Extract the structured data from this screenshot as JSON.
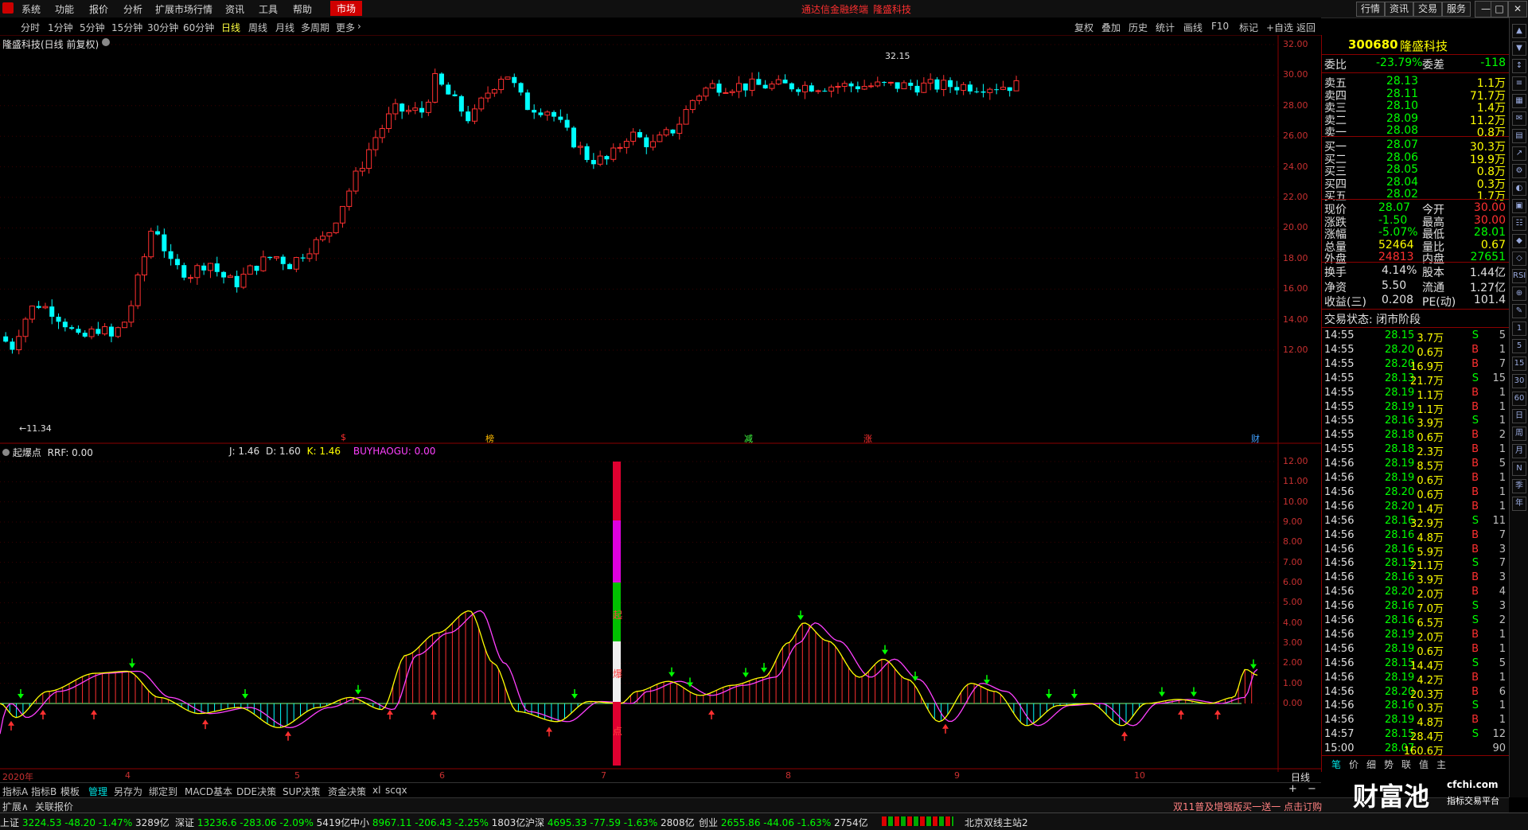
{
  "titlebar": {
    "menu": [
      "系统",
      "功能",
      "报价",
      "分析",
      "扩展市场行情",
      "资讯",
      "工具",
      "帮助"
    ],
    "market_tab": "市场",
    "title": "通达信金融终端",
    "stock_title": "隆盛科技",
    "right_buttons": [
      "行情",
      "资讯",
      "交易",
      "服务"
    ],
    "window_controls": [
      "—",
      "□",
      "✕"
    ]
  },
  "periodbar": {
    "periods": [
      "分时",
      "1分钟",
      "5分钟",
      "15分钟",
      "30分钟",
      "60分钟",
      "日线",
      "周线",
      "月线",
      "多周期",
      "更多"
    ],
    "active_period": "日线",
    "tools": [
      "复权",
      "叠加",
      "历史",
      "统计",
      "画线",
      "F10",
      "标记",
      "+自选",
      "返回"
    ]
  },
  "main_chart": {
    "label": "隆盛科技(日线 前复权)",
    "high_label": "32.15",
    "low_label": "11.34",
    "y_ticks": [
      "32.00",
      "30.00",
      "28.00",
      "26.00",
      "24.00",
      "22.00",
      "20.00",
      "18.00",
      "16.00",
      "14.00",
      "12.00"
    ],
    "markers": [
      "$",
      "榜",
      "减",
      "涨",
      "财"
    ],
    "colors": {
      "up": "#ff3030",
      "down": "#00ffff",
      "bg": "#000000",
      "grid": "#5a0000"
    }
  },
  "indicator": {
    "name": "起爆点",
    "values": [
      {
        "label": "RRF: 0.00",
        "color": "#e0e0e0"
      },
      {
        "label": "J: 1.46",
        "color": "#e0e0e0"
      },
      {
        "label": "D: 1.60",
        "color": "#e0e0e0"
      },
      {
        "label": "K: 1.46",
        "color": "#ffff00"
      },
      {
        "label": "BUYHAOGU: 0.00",
        "color": "#ff40ff"
      }
    ],
    "y_ticks": [
      "12.00",
      "11.00",
      "10.00",
      "9.00",
      "8.00",
      "7.00",
      "6.00",
      "5.00",
      "4.00",
      "3.00",
      "2.00",
      "1.00",
      "0.00"
    ],
    "bar_text": [
      "起",
      "爆",
      "点"
    ]
  },
  "date_axis": [
    "2020年",
    "4",
    "5",
    "6",
    "7",
    "8",
    "9",
    "10"
  ],
  "period_tag": "日线",
  "bottom_tabs": [
    "指标A",
    "指标B",
    "模板",
    "管理",
    "另存为",
    "绑定到",
    "MACD基本",
    "DDE决策",
    "SUP决策",
    "资金决策",
    "xl",
    "scqx"
  ],
  "active_tab": "管理",
  "bottom_row2": [
    "扩展∧",
    "关联报价"
  ],
  "ad_text": "双11普及增强版买一送一 点击订购",
  "quote": {
    "code": "300680",
    "name": "隆盛科技",
    "weibi": {
      "label": "委比",
      "value": "-23.79%",
      "label2": "委差",
      "value2": "-118"
    },
    "sell": [
      {
        "label": "卖五",
        "price": "28.13",
        "vol": "1.1万"
      },
      {
        "label": "卖四",
        "price": "28.11",
        "vol": "71.7万"
      },
      {
        "label": "卖三",
        "price": "28.10",
        "vol": "1.4万"
      },
      {
        "label": "卖二",
        "price": "28.09",
        "vol": "11.2万"
      },
      {
        "label": "卖一",
        "price": "28.08",
        "vol": "0.8万"
      }
    ],
    "buy": [
      {
        "label": "买一",
        "price": "28.07",
        "vol": "30.3万"
      },
      {
        "label": "买二",
        "price": "28.06",
        "vol": "19.9万"
      },
      {
        "label": "买三",
        "price": "28.05",
        "vol": "0.8万"
      },
      {
        "label": "买四",
        "price": "28.04",
        "vol": "0.3万"
      },
      {
        "label": "买五",
        "price": "28.02",
        "vol": "1.7万"
      }
    ],
    "stats": [
      {
        "l1": "现价",
        "v1": "28.07",
        "l2": "今开",
        "v2": "30.00",
        "c1": "#00ff00",
        "c2": "#ff3030"
      },
      {
        "l1": "涨跌",
        "v1": "-1.50",
        "l2": "最高",
        "v2": "30.00",
        "c1": "#00ff00",
        "c2": "#ff3030"
      },
      {
        "l1": "涨幅",
        "v1": "-5.07%",
        "l2": "最低",
        "v2": "28.01",
        "c1": "#00ff00",
        "c2": "#00ff00"
      },
      {
        "l1": "总量",
        "v1": "52464",
        "l2": "量比",
        "v2": "0.67",
        "c1": "#ffff00",
        "c2": "#ffff00"
      },
      {
        "l1": "外盘",
        "v1": "24813",
        "l2": "内盘",
        "v2": "27651",
        "c1": "#ff3030",
        "c2": "#00ff00"
      }
    ],
    "stats2": [
      {
        "l1": "换手",
        "v1": "4.14%",
        "l2": "股本",
        "v2": "1.44亿"
      },
      {
        "l1": "净资",
        "v1": "5.50",
        "l2": "流通",
        "v2": "1.27亿"
      },
      {
        "l1": "收益(三)",
        "v1": "0.208",
        "l2": "PE(动)",
        "v2": "101.4"
      }
    ],
    "trade_status": "交易状态: 闭市阶段"
  },
  "ticks": [
    [
      "14:55",
      "28.15",
      "3.7万",
      "S",
      "5"
    ],
    [
      "14:55",
      "28.20",
      "0.6万",
      "B",
      "1"
    ],
    [
      "14:55",
      "28.20",
      "16.9万",
      "B",
      "7"
    ],
    [
      "14:55",
      "28.13",
      "21.7万",
      "S",
      "15"
    ],
    [
      "14:55",
      "28.19",
      "1.1万",
      "B",
      "1"
    ],
    [
      "14:55",
      "28.19",
      "1.1万",
      "B",
      "1"
    ],
    [
      "14:55",
      "28.16",
      "3.9万",
      "S",
      "1"
    ],
    [
      "14:55",
      "28.18",
      "0.6万",
      "B",
      "2"
    ],
    [
      "14:55",
      "28.18",
      "2.3万",
      "B",
      "1"
    ],
    [
      "14:56",
      "28.19",
      "8.5万",
      "B",
      "5"
    ],
    [
      "14:56",
      "28.19",
      "0.6万",
      "B",
      "1"
    ],
    [
      "14:56",
      "28.20",
      "0.6万",
      "B",
      "1"
    ],
    [
      "14:56",
      "28.20",
      "1.4万",
      "B",
      "1"
    ],
    [
      "14:56",
      "28.16",
      "32.9万",
      "S",
      "11"
    ],
    [
      "14:56",
      "28.16",
      "4.8万",
      "B",
      "7"
    ],
    [
      "14:56",
      "28.16",
      "5.9万",
      "B",
      "3"
    ],
    [
      "14:56",
      "28.15",
      "21.1万",
      "S",
      "7"
    ],
    [
      "14:56",
      "28.16",
      "3.9万",
      "B",
      "3"
    ],
    [
      "14:56",
      "28.20",
      "2.0万",
      "B",
      "4"
    ],
    [
      "14:56",
      "28.16",
      "7.0万",
      "S",
      "3"
    ],
    [
      "14:56",
      "28.16",
      "6.5万",
      "S",
      "2"
    ],
    [
      "14:56",
      "28.19",
      "2.0万",
      "B",
      "1"
    ],
    [
      "14:56",
      "28.19",
      "0.6万",
      "B",
      "1"
    ],
    [
      "14:56",
      "28.15",
      "14.4万",
      "S",
      "5"
    ],
    [
      "14:56",
      "28.19",
      "4.2万",
      "B",
      "1"
    ],
    [
      "14:56",
      "28.20",
      "20.3万",
      "B",
      "6"
    ],
    [
      "14:56",
      "28.16",
      "0.3万",
      "S",
      "1"
    ],
    [
      "14:56",
      "28.19",
      "4.8万",
      "B",
      "1"
    ],
    [
      "14:57",
      "28.15",
      "28.4万",
      "S",
      "12"
    ],
    [
      "15:00",
      "28.07",
      "160.6万",
      "",
      "90"
    ]
  ],
  "tick_tabs": [
    "笔",
    "价",
    "细",
    "势",
    "联",
    "值",
    "主"
  ],
  "statusbar": [
    {
      "name": "上证",
      "val": "3224.53",
      "chg": "-48.20",
      "pct": "-1.47%",
      "amt": "3289亿"
    },
    {
      "name": "深证",
      "val": "13236.6",
      "chg": "-283.06",
      "pct": "-2.09%",
      "amt": "5419亿"
    },
    {
      "name": "中小",
      "val": "8967.11",
      "chg": "-206.43",
      "pct": "-2.25%",
      "amt": "1803亿"
    },
    {
      "name": "沪深",
      "val": "4695.33",
      "chg": "-77.59",
      "pct": "-1.63%",
      "amt": "2808亿"
    },
    {
      "name": "创业",
      "val": "2655.86",
      "chg": "-44.06",
      "pct": "-1.63%",
      "amt": "2754亿"
    }
  ],
  "server": "北京双线主站2",
  "watermark": "财富池",
  "watermark_url": "cfchi.com",
  "watermark_sub": "指标交易平台",
  "side_icons": [
    "▲",
    "▼",
    "↕",
    "≡",
    "▦",
    "✉",
    "▤",
    "↗",
    "⚙",
    "◐",
    "▣",
    "☷",
    "◆",
    "◇",
    "RSI",
    "⊕",
    "✎",
    "1",
    "5",
    "15",
    "30",
    "60",
    "日",
    "周",
    "月",
    "N",
    "季",
    "年"
  ]
}
